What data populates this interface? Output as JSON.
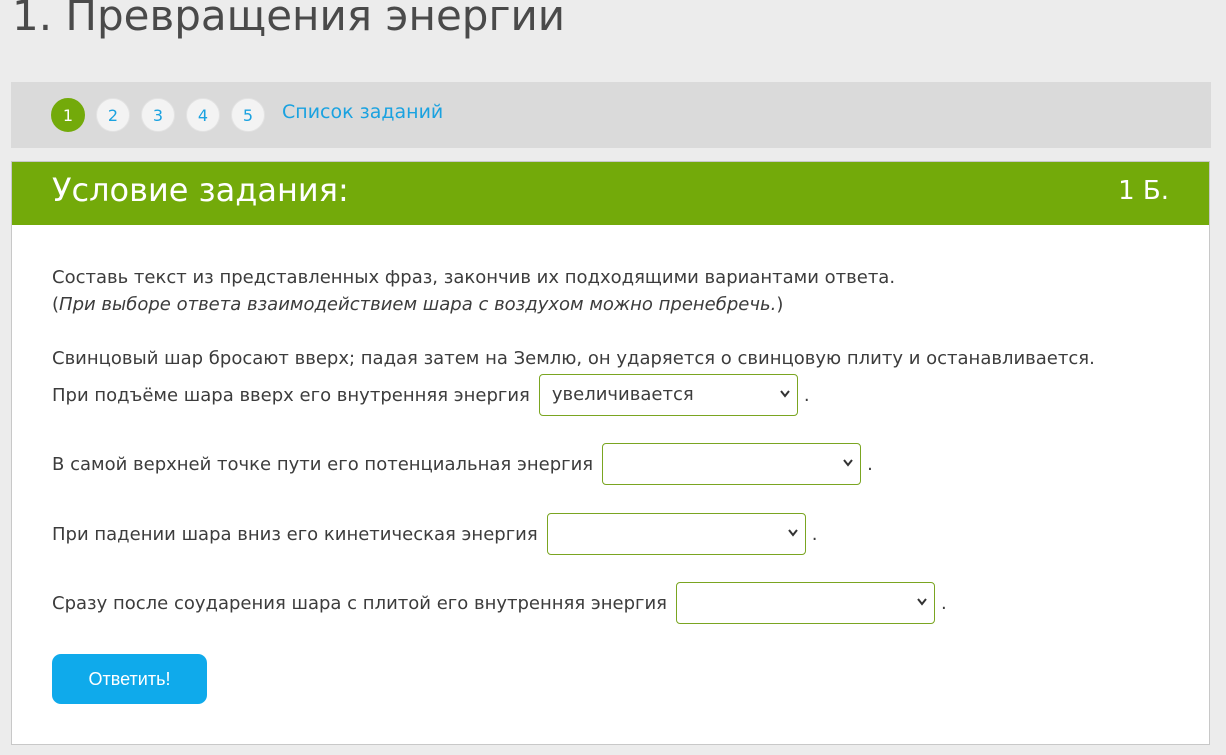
{
  "page": {
    "title": "1. Превращения энергии"
  },
  "pager": {
    "items": [
      "1",
      "2",
      "3",
      "4",
      "5"
    ],
    "active": "1",
    "list_link": "Список заданий"
  },
  "task": {
    "header_title": "Условие задания:",
    "points": "1 Б.",
    "instruction": "Составь текст из представленных фраз, закончив их подходящими вариантами ответа.",
    "note_open": "(",
    "note": "При выборе ответа взаимодействием шара с воздухом можно пренебречь.",
    "note_close": ")",
    "intro": "Свинцовый шар бросают вверх; падая затем на Землю, он ударяется о свинцовую плиту и останавливается.",
    "rows": [
      {
        "text": "При подъёме шара вверх его внутренняя энергия",
        "selected": "увеличивается",
        "end": "."
      },
      {
        "text": "В самой верхней точке пути его потенциальная энергия",
        "selected": "",
        "end": "."
      },
      {
        "text": "При падении шара вниз его кинетическая энергия",
        "selected": "",
        "end": "."
      },
      {
        "text": "Сразу после соударения шара с плитой его внутренняя энергия",
        "selected": "",
        "end": "."
      }
    ],
    "submit_label": "Ответить!"
  },
  "colors": {
    "accent_green": "#73aa0a",
    "link_blue": "#1aa2e0",
    "button_blue": "#0faaeb"
  }
}
